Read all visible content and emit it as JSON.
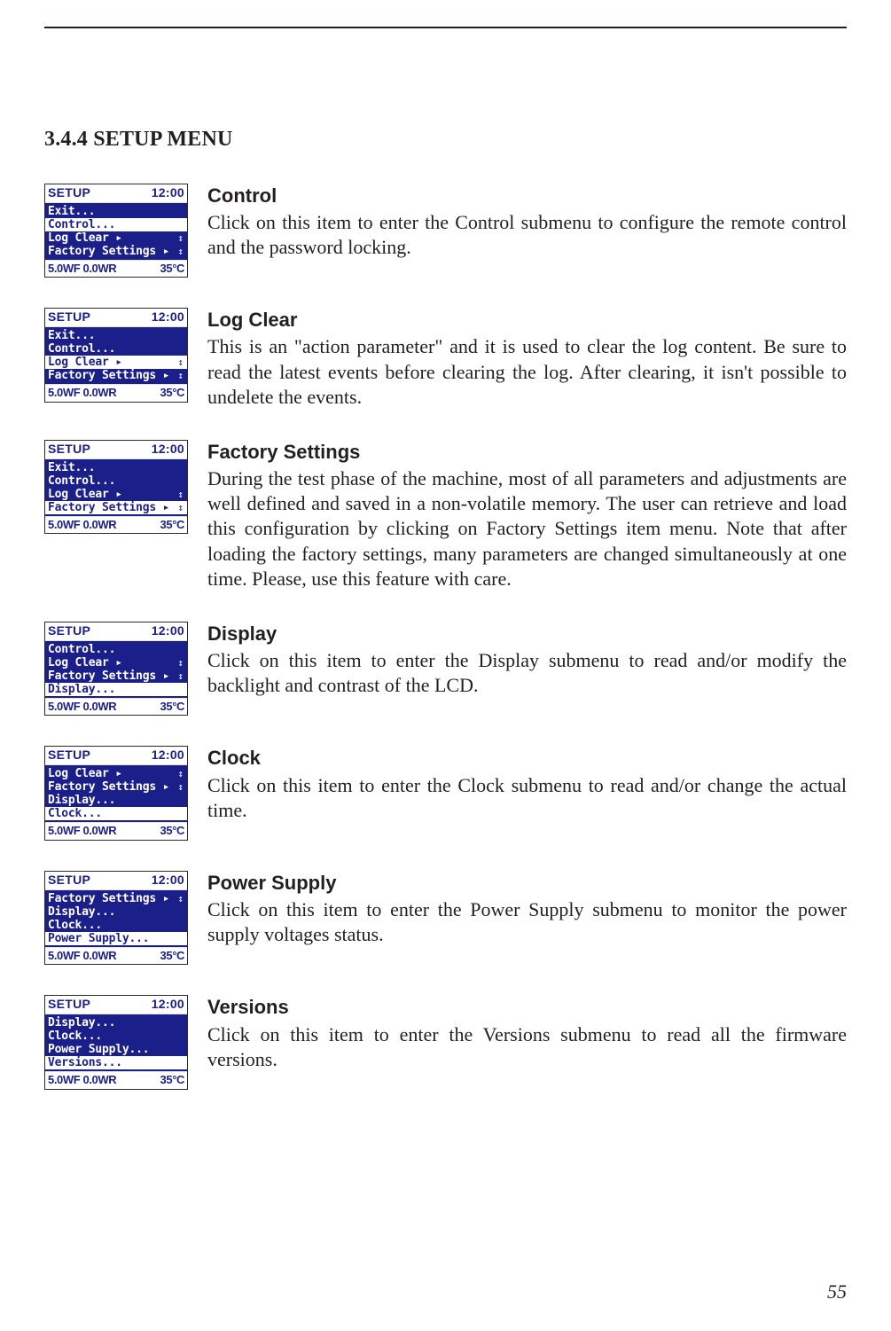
{
  "page": {
    "section_heading": "3.4.4 SETUP MENU",
    "number": "55"
  },
  "lcd_common": {
    "header_left": "SETUP",
    "header_right": "12:00",
    "footer_left": "5.0W",
    "footer_sub_left": "F",
    "footer_mid": "0.0W",
    "footer_sub_mid": "R",
    "footer_right": "35°C"
  },
  "entries": [
    {
      "title": "Control",
      "body": "Click on this item to enter the Control submenu to configure the remote control and the password locking.",
      "selected": 1,
      "rows": [
        {
          "label": "Exit...",
          "arrow": ""
        },
        {
          "label": "Control...",
          "arrow": ""
        },
        {
          "label": "Log Clear ▸",
          "arrow": "↕"
        },
        {
          "label": "Factory Settings ▸",
          "arrow": "↕"
        }
      ]
    },
    {
      "title": "Log Clear",
      "body": "This is an \"action parameter\" and it is used to clear the log content. Be sure to read the latest events before clearing the log. After clearing, it isn't possible to undelete the events.",
      "selected": 2,
      "rows": [
        {
          "label": "Exit...",
          "arrow": ""
        },
        {
          "label": "Control...",
          "arrow": ""
        },
        {
          "label": "Log Clear ▸",
          "arrow": "↕"
        },
        {
          "label": "Factory Settings ▸",
          "arrow": "↕"
        }
      ]
    },
    {
      "title": "Factory Settings",
      "body": "During the test phase of the machine, most of all parameters and adjustments are well defined and saved in a non-volatile memory. The user can retrieve and load this configuration by clicking on Factory Settings item menu. Note that after loading the factory settings, many parameters are changed simultaneously at one time. Please, use this feature with care.",
      "selected": 3,
      "rows": [
        {
          "label": "Exit...",
          "arrow": ""
        },
        {
          "label": "Control...",
          "arrow": ""
        },
        {
          "label": "Log Clear ▸",
          "arrow": "↕"
        },
        {
          "label": "Factory Settings ▸",
          "arrow": "↕"
        }
      ]
    },
    {
      "title": "Display",
      "body": "Click on this item to enter the Display submenu to read and/or modify the backlight and contrast of the LCD.",
      "selected": 3,
      "rows": [
        {
          "label": "Control...",
          "arrow": ""
        },
        {
          "label": "Log Clear ▸",
          "arrow": "↕"
        },
        {
          "label": "Factory Settings ▸",
          "arrow": "↕"
        },
        {
          "label": "Display...",
          "arrow": ""
        }
      ]
    },
    {
      "title": "Clock",
      "body": "Click on this item to enter the Clock submenu to read and/or change the actual time.",
      "selected": 3,
      "rows": [
        {
          "label": "Log Clear ▸",
          "arrow": "↕"
        },
        {
          "label": "Factory Settings ▸",
          "arrow": "↕"
        },
        {
          "label": "Display...",
          "arrow": ""
        },
        {
          "label": "Clock...",
          "arrow": ""
        }
      ]
    },
    {
      "title": "Power Supply",
      "body": "Click on this item to enter the Power Supply submenu to monitor the power supply voltages status.",
      "selected": 3,
      "rows": [
        {
          "label": "Factory Settings ▸",
          "arrow": "↕"
        },
        {
          "label": "Display...",
          "arrow": ""
        },
        {
          "label": "Clock...",
          "arrow": ""
        },
        {
          "label": "Power Supply...",
          "arrow": ""
        }
      ]
    },
    {
      "title": "Versions",
      "body": "Click on this item to enter the Versions submenu to read all the firmware versions.",
      "selected": 3,
      "rows": [
        {
          "label": "Display...",
          "arrow": ""
        },
        {
          "label": "Clock...",
          "arrow": ""
        },
        {
          "label": "Power Supply...",
          "arrow": ""
        },
        {
          "label": "Versions...",
          "arrow": ""
        }
      ]
    }
  ]
}
